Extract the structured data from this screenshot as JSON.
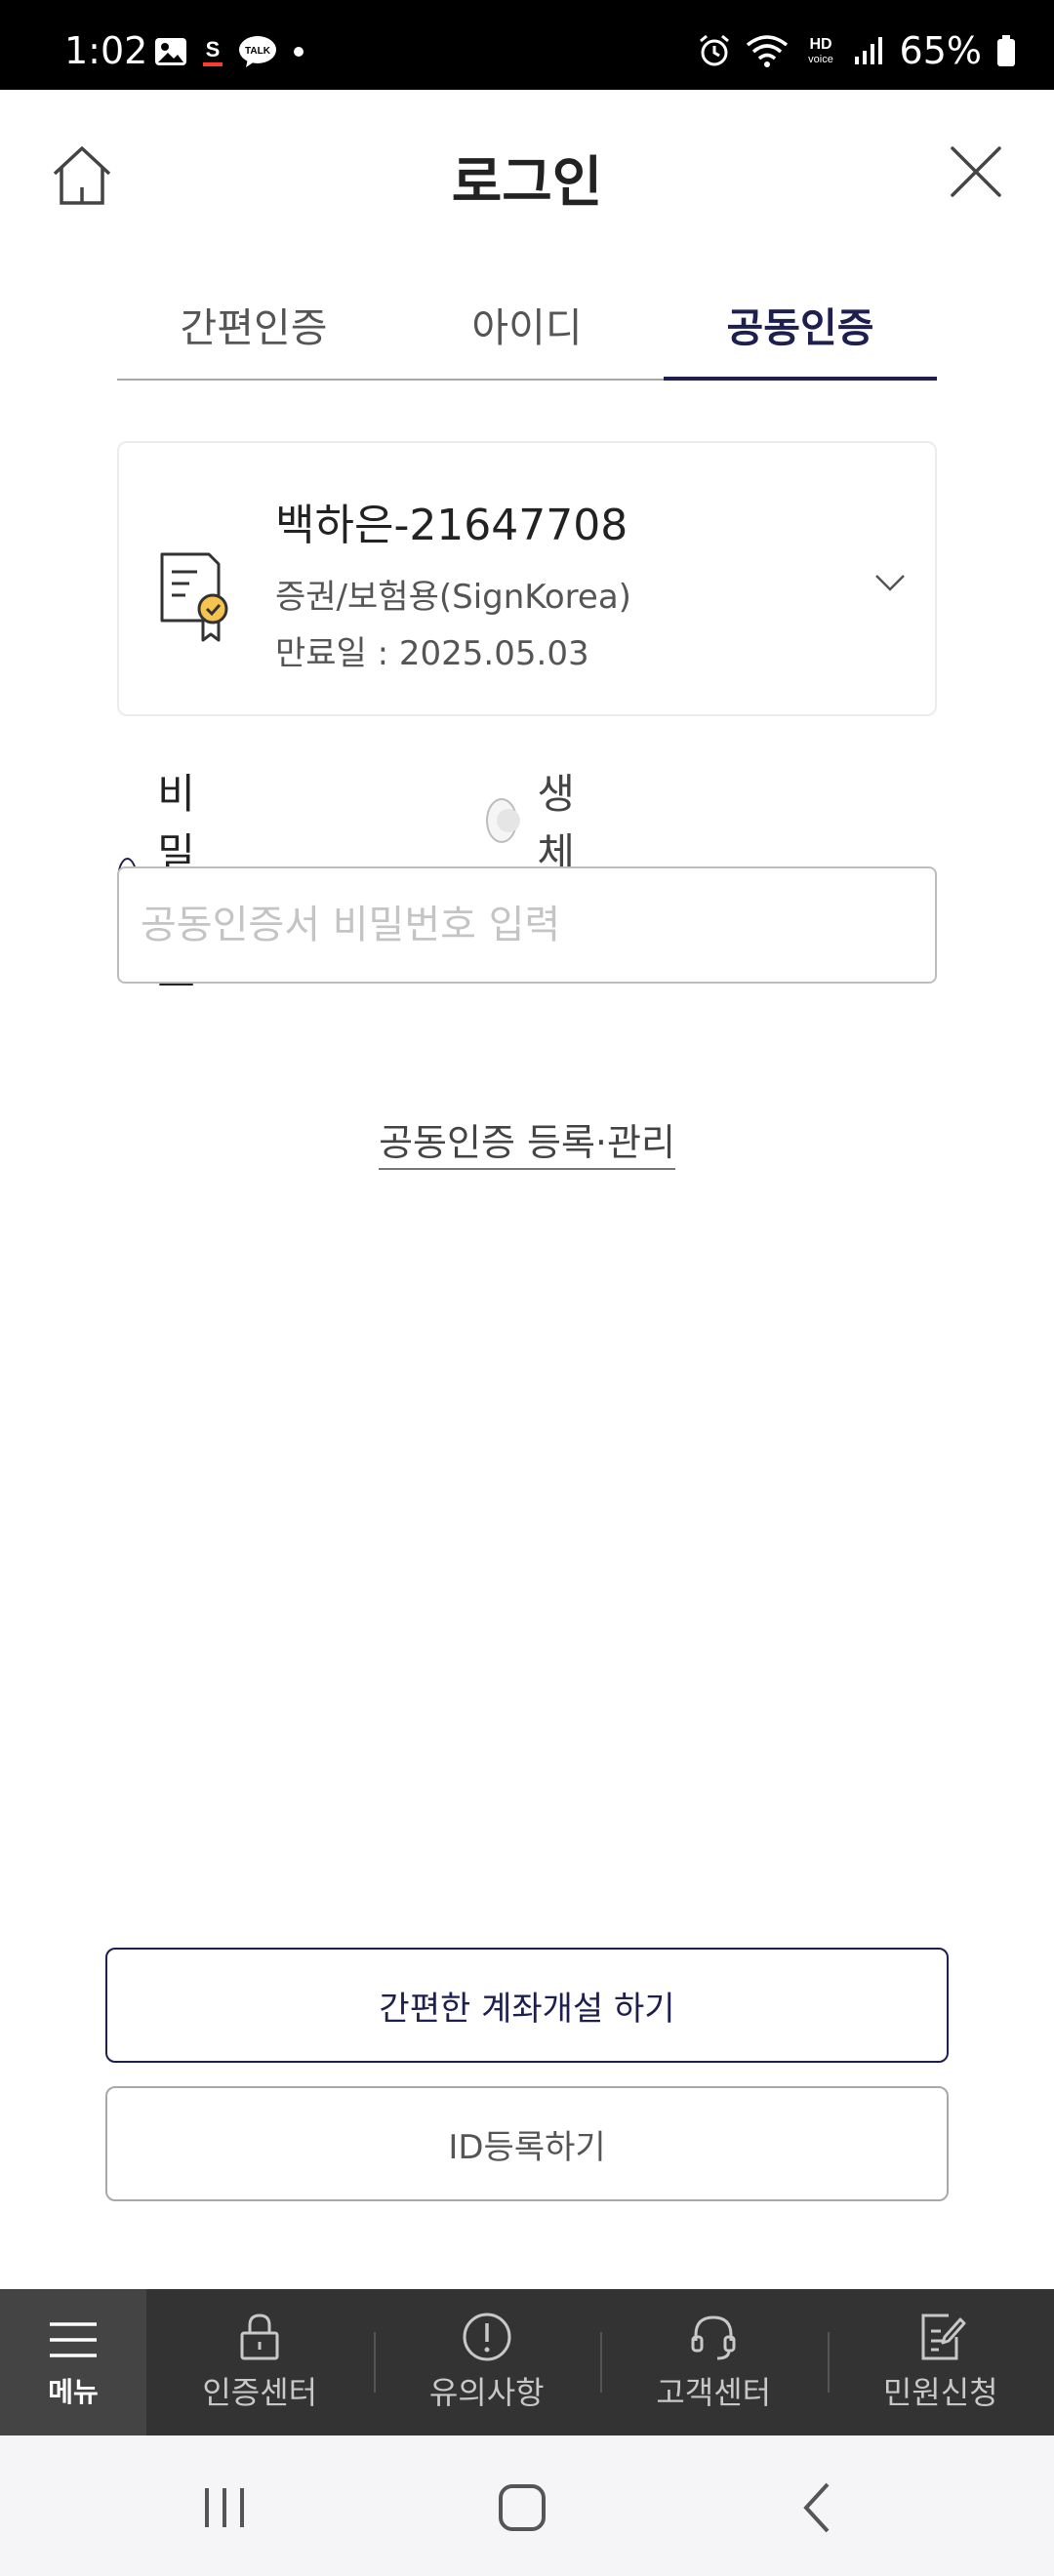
{
  "status_bar": {
    "time": "1:02",
    "left_icons": [
      "gallery-icon",
      "s-app-icon",
      "talk-icon",
      "dot-icon"
    ],
    "battery_percent": "65%",
    "hd_label": "HD",
    "voice_label": "voice",
    "s_label": "S",
    "talk_label": "TALK"
  },
  "header": {
    "title": "로그인"
  },
  "tabs": [
    {
      "label": "간편인증",
      "active": false
    },
    {
      "label": "아이디",
      "active": false
    },
    {
      "label": "공동인증",
      "active": true
    }
  ],
  "certificate": {
    "name": "백하은-21647708",
    "type": "증권/보험용(SignKorea)",
    "expiry": "만료일 : 2025.05.03"
  },
  "auth_method": {
    "options": [
      {
        "label": "비밀번호",
        "checked": true
      },
      {
        "label": "생체",
        "checked": false
      }
    ]
  },
  "password_input": {
    "placeholder": "공동인증서 비밀번호 입력",
    "value": ""
  },
  "manage_link": "공동인증 등록·관리",
  "buttons": {
    "open_account": "간편한 계좌개설 하기",
    "register_id": "ID등록하기"
  },
  "bottom_nav": [
    {
      "label": "메뉴",
      "icon": "hamburger-icon"
    },
    {
      "label": "인증센터",
      "icon": "lock-icon"
    },
    {
      "label": "유의사항",
      "icon": "alert-icon"
    },
    {
      "label": "고객센터",
      "icon": "headset-icon"
    },
    {
      "label": "민원신청",
      "icon": "document-edit-icon"
    }
  ],
  "colors": {
    "accent": "#1d1f4f",
    "nav_bg": "#333333",
    "status_bg": "#000000"
  }
}
